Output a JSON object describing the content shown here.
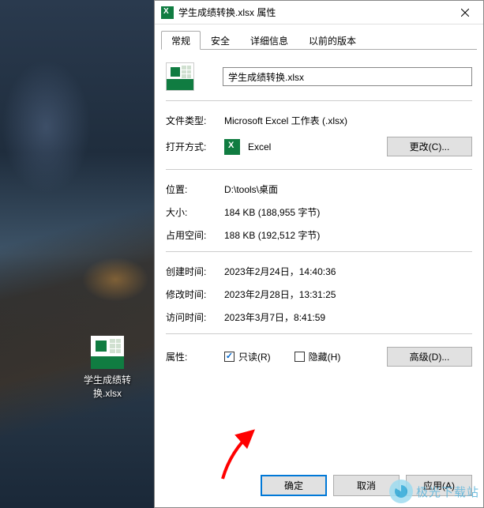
{
  "desktop": {
    "file_label": "学生成绩转换.xlsx"
  },
  "dialog": {
    "title": "学生成绩转换.xlsx 属性",
    "tabs": [
      "常规",
      "安全",
      "详细信息",
      "以前的版本"
    ],
    "active_tab": 0,
    "filename": "学生成绩转换.xlsx",
    "filetype_label": "文件类型:",
    "filetype_value": "Microsoft Excel 工作表 (.xlsx)",
    "openwith_label": "打开方式:",
    "openwith_app": "Excel",
    "change_btn": "更改(C)...",
    "location_label": "位置:",
    "location_value": "D:\\tools\\桌面",
    "size_label": "大小:",
    "size_value": "184 KB (188,955 字节)",
    "sizedisk_label": "占用空间:",
    "sizedisk_value": "188 KB (192,512 字节)",
    "created_label": "创建时间:",
    "created_value": "2023年2月24日，14:40:36",
    "modified_label": "修改时间:",
    "modified_value": "2023年2月28日，13:31:25",
    "accessed_label": "访问时间:",
    "accessed_value": "2023年3月7日，8:41:59",
    "attr_label": "属性:",
    "readonly_label": "只读(R)",
    "readonly_checked": true,
    "hidden_label": "隐藏(H)",
    "hidden_checked": false,
    "advanced_btn": "高级(D)...",
    "ok_btn": "确定",
    "cancel_btn": "取消",
    "apply_btn": "应用(A)"
  },
  "watermark": "极光下载站"
}
